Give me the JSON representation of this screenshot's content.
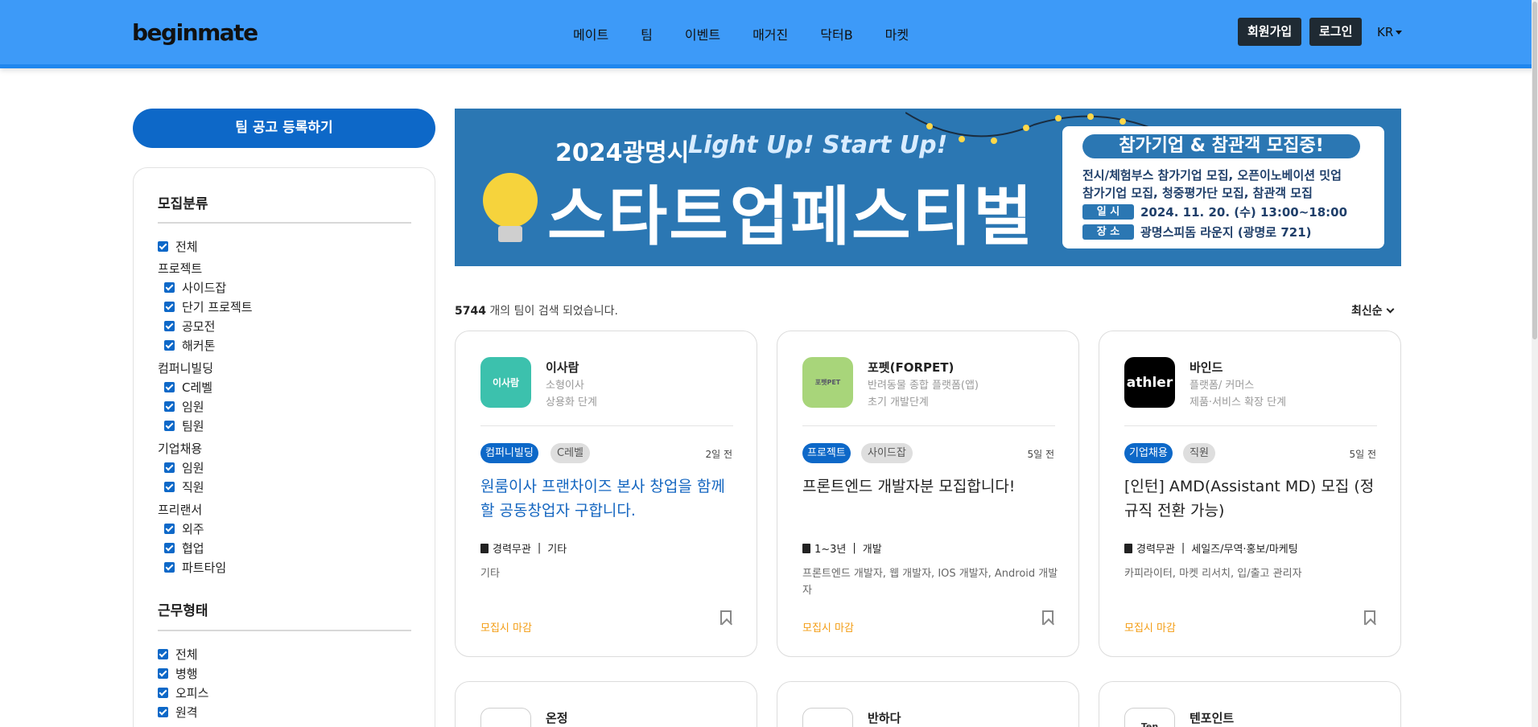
{
  "header": {
    "logo": "beginmate",
    "nav": [
      "메이트",
      "팀",
      "이벤트",
      "매거진",
      "닥터B",
      "마켓"
    ],
    "signup_label": "회원가입",
    "login_label": "로그인",
    "language": "KR"
  },
  "sidebar": {
    "register_label": "팀 공고 등록하기",
    "recruit_title": "모집분류",
    "all_label": "전체",
    "groups": [
      {
        "label": "프로젝트",
        "items": [
          "사이드잡",
          "단기 프로젝트",
          "공모전",
          "해커톤"
        ]
      },
      {
        "label": "컴퍼니빌딩",
        "items": [
          "C레벨",
          "임원",
          "팀원"
        ]
      },
      {
        "label": "기업채용",
        "items": [
          "임원",
          "직원"
        ]
      },
      {
        "label": "프리랜서",
        "items": [
          "외주",
          "협업",
          "파트타임"
        ]
      }
    ],
    "work_title": "근무형태",
    "work_items": [
      "전체",
      "병행",
      "오피스",
      "원격"
    ]
  },
  "banner": {
    "year": "2024광명시",
    "slogan": "Light Up! Start Up!",
    "headline": "스타트업페스티벌",
    "pill": "참가기업 & 참관객 모집중!",
    "line1": "전시/체험부스 참가기업 모집, 오픈이노베이션 밋업",
    "line2": "참가기업 모집, 청중평가단 모집, 참관객 모집",
    "date_tag": "일 시",
    "date_value": "2024. 11. 20. (수) 13:00~18:00",
    "place_tag": "장 소",
    "place_value": "광명스피돔 라운지 (광명로 721)"
  },
  "results": {
    "count": "5744",
    "count_suffix": " 개의 팀이 검색 되었습니다.",
    "sort_label": "최신순"
  },
  "cards": [
    {
      "name": "이사람",
      "sub1": "소형이사",
      "sub2": "상용화 단계",
      "logo_text": "이사람",
      "logo_color": "#3cc1ad",
      "tag1": "컴퍼니빌딩",
      "tag2": "C레벨",
      "date": "2일 전",
      "title": "원룸이사 프랜차이즈 본사 창업을 함께할 공동창업자 구합니다.",
      "meta1": "경력무관",
      "meta2": "기타",
      "desc": "기타",
      "deadline": "모집시 마감"
    },
    {
      "name": "포펫(FORPET)",
      "sub1": "반려동물 종합 플랫폼(앱)",
      "sub2": "초기 개발단계",
      "logo_text": "포펫PET",
      "logo_color": "#a8d57a",
      "tag1": "프로젝트",
      "tag2": "사이드잡",
      "date": "5일 전",
      "title": "프론트엔드 개발자분 모집합니다!",
      "meta1": "1~3년",
      "meta2": "개발",
      "desc": "프론트엔드 개발자, 웹 개발자, IOS 개발자, Android 개발자",
      "deadline": "모집시 마감"
    },
    {
      "name": "바인드",
      "sub1": "플랫폼/ 커머스",
      "sub2": "제품·서비스 확장 단계",
      "logo_text": "athler",
      "logo_color": "#000000",
      "tag1": "기업채용",
      "tag2": "직원",
      "date": "5일 전",
      "title": "[인턴] AMD(Assistant MD) 모집 (정규직 전환 가능)",
      "meta1": "경력무관",
      "meta2": "세일즈/무역·홍보/마케팅",
      "desc": "카피라이터, 마켓 리서치, 입/출고 관리자",
      "deadline": "모집시 마감"
    }
  ],
  "cards_row2": [
    {
      "name": "온정"
    },
    {
      "name": "반하다"
    },
    {
      "name": "텐포인트",
      "logo_text": "Ten"
    }
  ]
}
